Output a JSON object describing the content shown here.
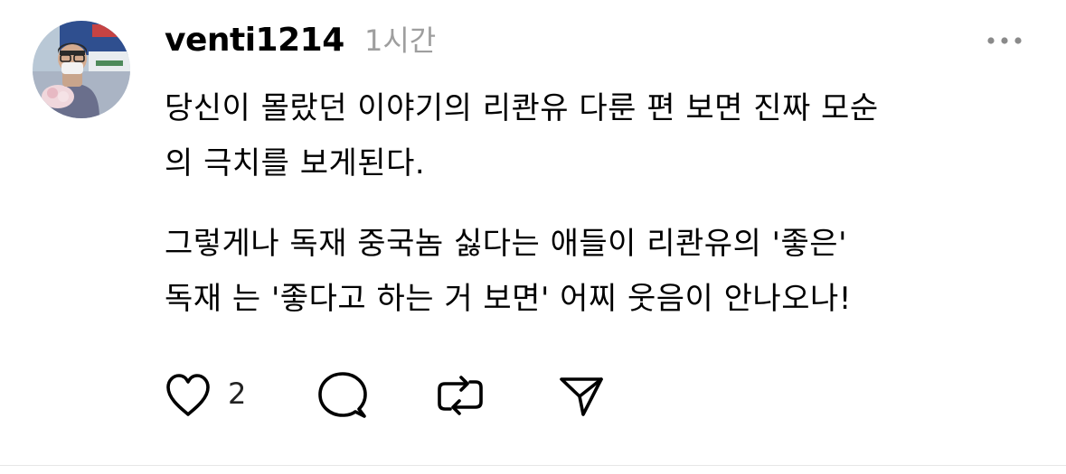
{
  "post": {
    "author": {
      "username": "venti1214",
      "avatar_icon": "profile-photo"
    },
    "timestamp": "1시간",
    "body": {
      "paragraph1": {
        "line1": "당신이 몰랐던 이야기의 리콴유 다룬 편 보면 진짜 모순",
        "line2": "의 극치를 보게된다."
      },
      "paragraph2": {
        "line1": "그렇게나 독재 중국놈 싫다는 애들이 리콴유의 '좋은'",
        "line2": "독재 는 '좋다고 하는 거 보면' 어찌 웃음이 안나오나!"
      }
    },
    "actions": {
      "like": {
        "icon": "heart-icon",
        "count": "2"
      },
      "reply": {
        "icon": "speech-bubble-icon"
      },
      "repost": {
        "icon": "repost-icon"
      },
      "share": {
        "icon": "send-icon"
      }
    },
    "more_icon": "more-horizontal-icon"
  },
  "colors": {
    "text": "#000000",
    "muted": "#9e9e9e",
    "icon": "#000000"
  }
}
